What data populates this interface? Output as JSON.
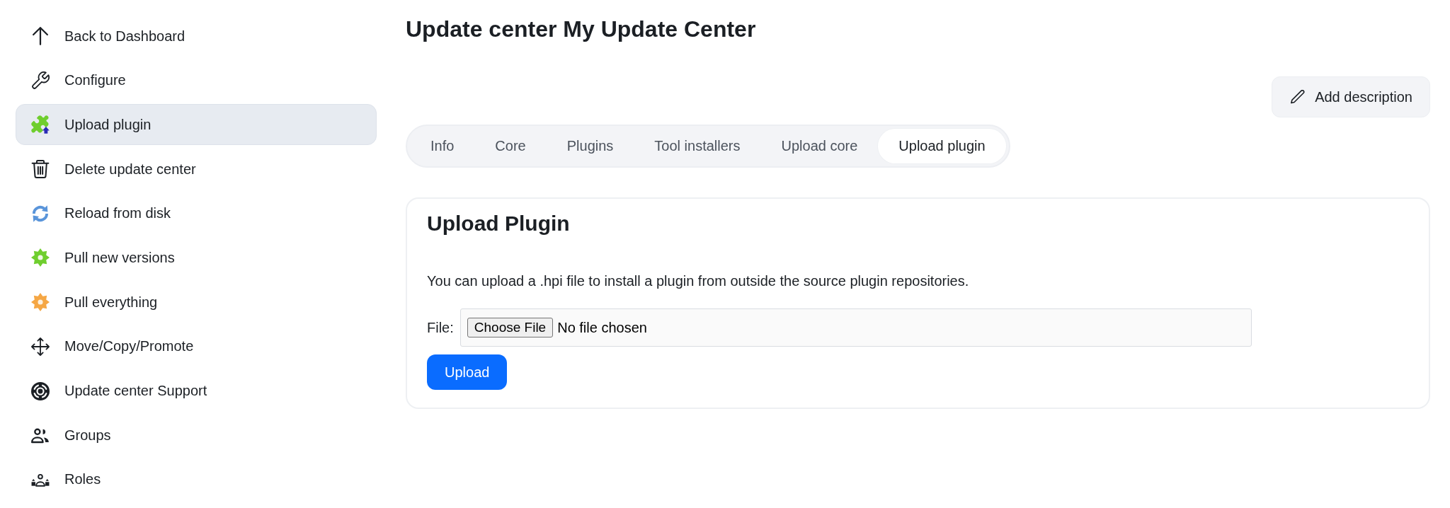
{
  "sidebar": {
    "items": [
      {
        "label": "Back to Dashboard",
        "selected": false
      },
      {
        "label": "Configure",
        "selected": false
      },
      {
        "label": "Upload plugin",
        "selected": true
      },
      {
        "label": "Delete update center",
        "selected": false
      },
      {
        "label": "Reload from disk",
        "selected": false
      },
      {
        "label": "Pull new versions",
        "selected": false
      },
      {
        "label": "Pull everything",
        "selected": false
      },
      {
        "label": "Move/Copy/Promote",
        "selected": false
      },
      {
        "label": "Update center Support",
        "selected": false
      },
      {
        "label": "Groups",
        "selected": false
      },
      {
        "label": "Roles",
        "selected": false
      }
    ]
  },
  "page": {
    "title": "Update center My Update Center",
    "add_description_button": "Add description"
  },
  "tabs": [
    {
      "label": "Info",
      "selected": false
    },
    {
      "label": "Core",
      "selected": false
    },
    {
      "label": "Plugins",
      "selected": false
    },
    {
      "label": "Tool installers",
      "selected": false
    },
    {
      "label": "Upload core",
      "selected": false
    },
    {
      "label": "Upload plugin",
      "selected": true
    }
  ],
  "panel": {
    "title": "Upload Plugin",
    "description": "You can upload a .hpi file to install a plugin from outside the source plugin repositories.",
    "file_field": {
      "label": "File:",
      "button": "Choose File",
      "status": "No file chosen"
    },
    "submit_button": "Upload"
  }
}
